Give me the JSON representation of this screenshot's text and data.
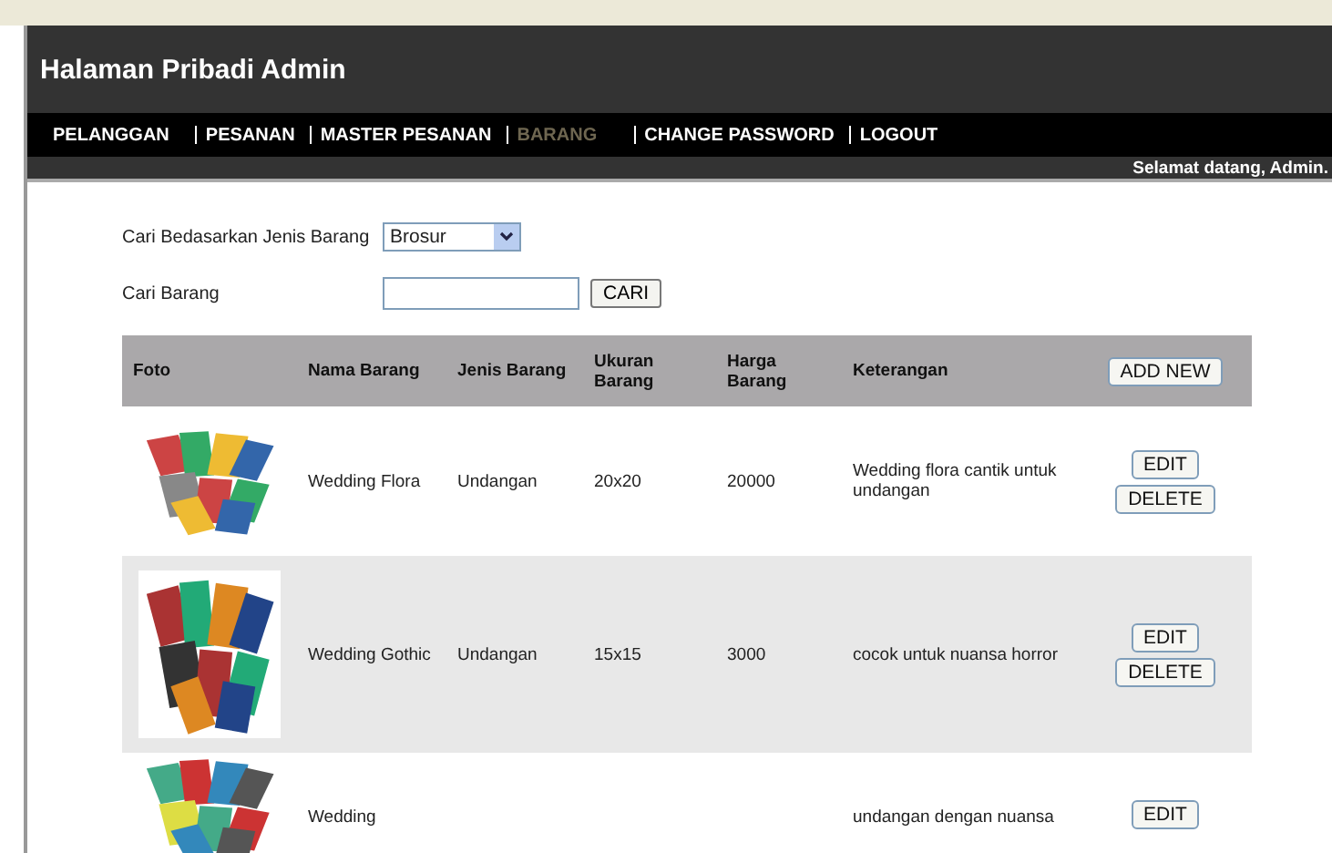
{
  "header": {
    "title": "Halaman Pribadi Admin"
  },
  "nav": [
    {
      "label": "PELANGGAN",
      "selected": false
    },
    {
      "label": "PESANAN",
      "selected": false
    },
    {
      "label": "MASTER PESANAN",
      "selected": false
    },
    {
      "label": "BARANG",
      "selected": true
    },
    {
      "label": "CHANGE PASSWORD",
      "selected": false
    },
    {
      "label": "LOGOUT",
      "selected": false
    }
  ],
  "welcome": "Selamat datang, Admin.",
  "filter": {
    "type_label": "Cari Bedasarkan Jenis Barang",
    "type_value": "Brosur",
    "search_label": "Cari Barang",
    "search_button": "CARI"
  },
  "table": {
    "columns": [
      "Foto",
      "Nama Barang",
      "Jenis Barang",
      "Ukuran Barang",
      "Harga Barang",
      "Keterangan"
    ],
    "add_button": "ADD NEW",
    "rows": [
      {
        "photo": {
          "kind": "picture"
        },
        "name": "Wedding Flora",
        "type": "Undangan",
        "size": "20x20",
        "price": "20000",
        "note": "Wedding flora cantik untuk undangan",
        "buttons": [
          "EDIT",
          "DELETE"
        ]
      },
      {
        "photo": {
          "kind": "picture"
        },
        "name": "Wedding Gothic",
        "type": "Undangan",
        "size": "15x15",
        "price": "3000",
        "note": "cocok untuk nuansa horror",
        "buttons": [
          "EDIT",
          "DELETE"
        ]
      },
      {
        "photo": {
          "kind": "picture"
        },
        "name": "Wedding",
        "type": "",
        "size": "",
        "price": "",
        "note": "undangan dengan nuansa",
        "buttons": [
          "EDIT"
        ]
      }
    ]
  }
}
